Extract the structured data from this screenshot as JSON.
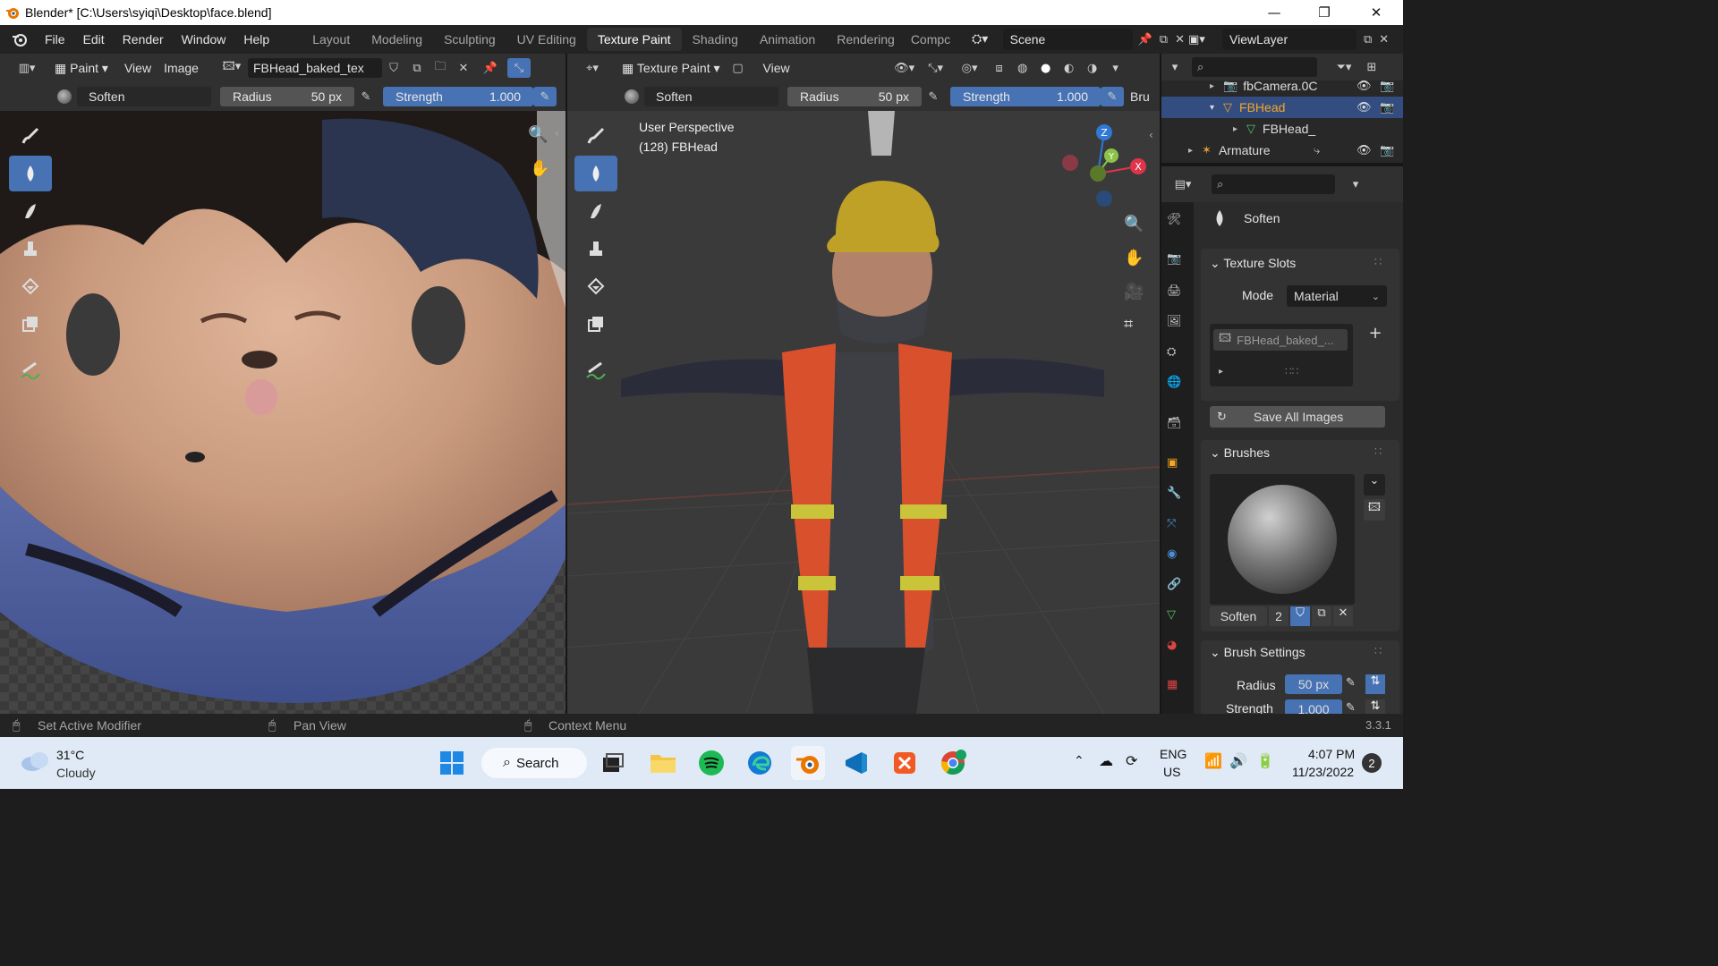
{
  "window": {
    "title": "Blender* [C:\\Users\\syiqi\\Desktop\\face.blend]",
    "minimize": "—",
    "restore": "❐",
    "close": "✕"
  },
  "menubar": {
    "items": [
      "File",
      "Edit",
      "Render",
      "Window",
      "Help"
    ],
    "workspaces": [
      "Layout",
      "Modeling",
      "Sculpting",
      "UV Editing",
      "Texture Paint",
      "Shading",
      "Animation",
      "Rendering",
      "Compc"
    ],
    "active_workspace": "Texture Paint",
    "scene": "Scene",
    "view_layer": "ViewLayer"
  },
  "image_editor": {
    "mode": "Paint",
    "view_menu": "View",
    "image_menu": "Image",
    "image_name": "FBHead_baked_tex",
    "brush_name": "Soften",
    "radius_label": "Radius",
    "radius_value": "50 px",
    "strength_label": "Strength",
    "strength_value": "1.000"
  },
  "viewport": {
    "mode": "Texture Paint",
    "view_menu": "View",
    "brush_name": "Soften",
    "radius_label": "Radius",
    "radius_value": "50 px",
    "strength_label": "Strength",
    "strength_value": "1.000",
    "overflow_text": "Bru",
    "overlay_title": "User Perspective",
    "overlay_object": "(128) FBHead",
    "gizmo": {
      "x": "X",
      "y": "Y",
      "z": "Z"
    }
  },
  "outliner": {
    "rows": [
      {
        "label": "fbCamera.0C",
        "indent": 1
      },
      {
        "label": "FBHead",
        "indent": 1,
        "selected": true
      },
      {
        "label": "FBHead_",
        "indent": 2
      },
      {
        "label": "Armature",
        "indent": 0
      }
    ]
  },
  "properties": {
    "brush_name": "Soften",
    "texture_slots": {
      "header": "Texture Slots",
      "mode_label": "Mode",
      "mode_value": "Material",
      "slot_name": "FBHead_baked_...",
      "save_all": "Save All Images"
    },
    "brushes": {
      "header": "Brushes",
      "brush_name": "Soften",
      "users": "2"
    },
    "brush_settings": {
      "header": "Brush Settings",
      "radius_label": "Radius",
      "radius_value": "50 px",
      "strength_label": "Strength",
      "strength_value": "1.000"
    }
  },
  "statusbar": {
    "hint1": "Set Active Modifier",
    "hint2": "Pan View",
    "hint3": "Context Menu",
    "version": "3.3.1"
  },
  "taskbar": {
    "weather_temp": "31°C",
    "weather_desc": "Cloudy",
    "search_label": "Search",
    "lang_top": "ENG",
    "lang_bottom": "US",
    "time": "4:07 PM",
    "date": "11/23/2022",
    "notification_count": "2"
  },
  "colors": {
    "accent_blue": "#4772b3",
    "selected_orange": "#f5a623",
    "axis_x": "#e0344b",
    "axis_y": "#8bc34a",
    "axis_z": "#2f78d6"
  }
}
